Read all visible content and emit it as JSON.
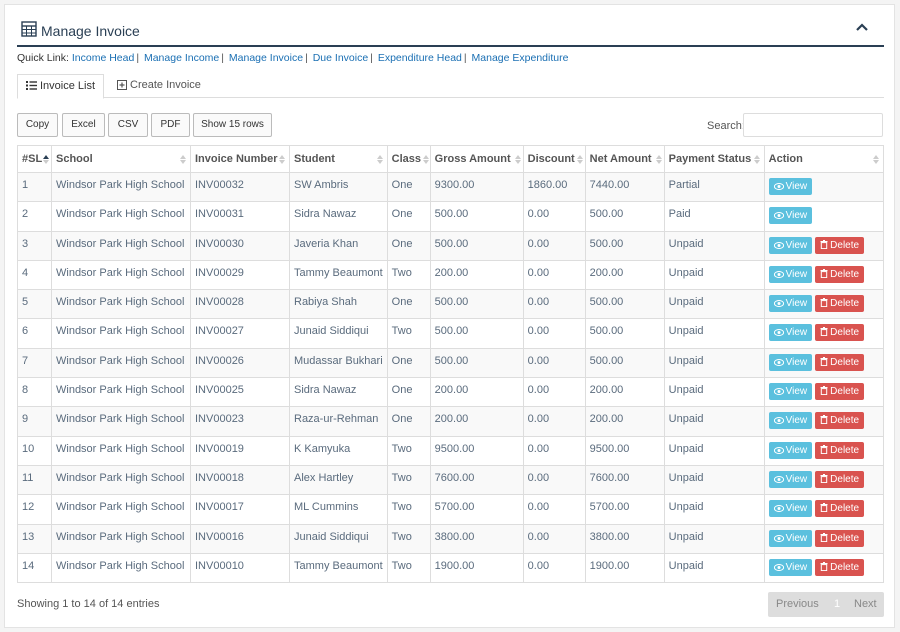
{
  "header": {
    "title": "Manage Invoice"
  },
  "quick_links": {
    "label": "Quick Link:",
    "items": [
      "Income Head",
      "Manage Income",
      "Manage Invoice",
      "Due Invoice",
      "Expenditure Head",
      "Manage Expenditure"
    ]
  },
  "tabs": [
    {
      "label": "Invoice List",
      "icon": "list-icon",
      "active": true
    },
    {
      "label": "Create Invoice",
      "icon": "plus-square-icon",
      "active": false
    }
  ],
  "export_buttons": [
    "Copy",
    "Excel",
    "CSV",
    "PDF",
    "Show 15 rows"
  ],
  "search": {
    "label": "Search:",
    "value": ""
  },
  "table": {
    "columns": [
      "#SL",
      "School",
      "Invoice Number",
      "Student",
      "Class",
      "Gross Amount",
      "Discount",
      "Net Amount",
      "Payment Status",
      "Action"
    ],
    "rows": [
      {
        "sl": "1",
        "school": "Windsor Park High School",
        "invoice": "INV00032",
        "student": "SW Ambris",
        "class": "One",
        "gross": "9300.00",
        "discount": "1860.00",
        "net": "7440.00",
        "status": "Partial",
        "delete": false
      },
      {
        "sl": "2",
        "school": "Windsor Park High School",
        "invoice": "INV00031",
        "student": "Sidra Nawaz",
        "class": "One",
        "gross": "500.00",
        "discount": "0.00",
        "net": "500.00",
        "status": "Paid",
        "delete": false
      },
      {
        "sl": "3",
        "school": "Windsor Park High School",
        "invoice": "INV00030",
        "student": "Javeria Khan",
        "class": "One",
        "gross": "500.00",
        "discount": "0.00",
        "net": "500.00",
        "status": "Unpaid",
        "delete": true
      },
      {
        "sl": "4",
        "school": "Windsor Park High School",
        "invoice": "INV00029",
        "student": "Tammy Beaumont",
        "class": "Two",
        "gross": "200.00",
        "discount": "0.00",
        "net": "200.00",
        "status": "Unpaid",
        "delete": true
      },
      {
        "sl": "5",
        "school": "Windsor Park High School",
        "invoice": "INV00028",
        "student": "Rabiya Shah",
        "class": "One",
        "gross": "500.00",
        "discount": "0.00",
        "net": "500.00",
        "status": "Unpaid",
        "delete": true
      },
      {
        "sl": "6",
        "school": "Windsor Park High School",
        "invoice": "INV00027",
        "student": "Junaid Siddiqui",
        "class": "Two",
        "gross": "500.00",
        "discount": "0.00",
        "net": "500.00",
        "status": "Unpaid",
        "delete": true
      },
      {
        "sl": "7",
        "school": "Windsor Park High School",
        "invoice": "INV00026",
        "student": "Mudassar Bukhari",
        "class": "One",
        "gross": "500.00",
        "discount": "0.00",
        "net": "500.00",
        "status": "Unpaid",
        "delete": true
      },
      {
        "sl": "8",
        "school": "Windsor Park High School",
        "invoice": "INV00025",
        "student": "Sidra Nawaz",
        "class": "One",
        "gross": "200.00",
        "discount": "0.00",
        "net": "200.00",
        "status": "Unpaid",
        "delete": true
      },
      {
        "sl": "9",
        "school": "Windsor Park High School",
        "invoice": "INV00023",
        "student": "Raza-ur-Rehman",
        "class": "One",
        "gross": "200.00",
        "discount": "0.00",
        "net": "200.00",
        "status": "Unpaid",
        "delete": true
      },
      {
        "sl": "10",
        "school": "Windsor Park High School",
        "invoice": "INV00019",
        "student": "K Kamyuka",
        "class": "Two",
        "gross": "9500.00",
        "discount": "0.00",
        "net": "9500.00",
        "status": "Unpaid",
        "delete": true
      },
      {
        "sl": "11",
        "school": "Windsor Park High School",
        "invoice": "INV00018",
        "student": "Alex Hartley",
        "class": "Two",
        "gross": "7600.00",
        "discount": "0.00",
        "net": "7600.00",
        "status": "Unpaid",
        "delete": true
      },
      {
        "sl": "12",
        "school": "Windsor Park High School",
        "invoice": "INV00017",
        "student": "ML Cummins",
        "class": "Two",
        "gross": "5700.00",
        "discount": "0.00",
        "net": "5700.00",
        "status": "Unpaid",
        "delete": true
      },
      {
        "sl": "13",
        "school": "Windsor Park High School",
        "invoice": "INV00016",
        "student": "Junaid Siddiqui",
        "class": "Two",
        "gross": "3800.00",
        "discount": "0.00",
        "net": "3800.00",
        "status": "Unpaid",
        "delete": true
      },
      {
        "sl": "14",
        "school": "Windsor Park High School",
        "invoice": "INV00010",
        "student": "Tammy Beaumont",
        "class": "Two",
        "gross": "1900.00",
        "discount": "0.00",
        "net": "1900.00",
        "status": "Unpaid",
        "delete": true
      }
    ],
    "view_label": "View",
    "delete_label": "Delete"
  },
  "footer": {
    "info": "Showing 1 to 14 of 14 entries"
  },
  "pagination": {
    "previous": "Previous",
    "current": "1",
    "next": "Next"
  },
  "colors": {
    "header_border": "#2a3f54",
    "link": "#1a6fb3",
    "view": "#5bc0de",
    "delete": "#d9534f"
  }
}
